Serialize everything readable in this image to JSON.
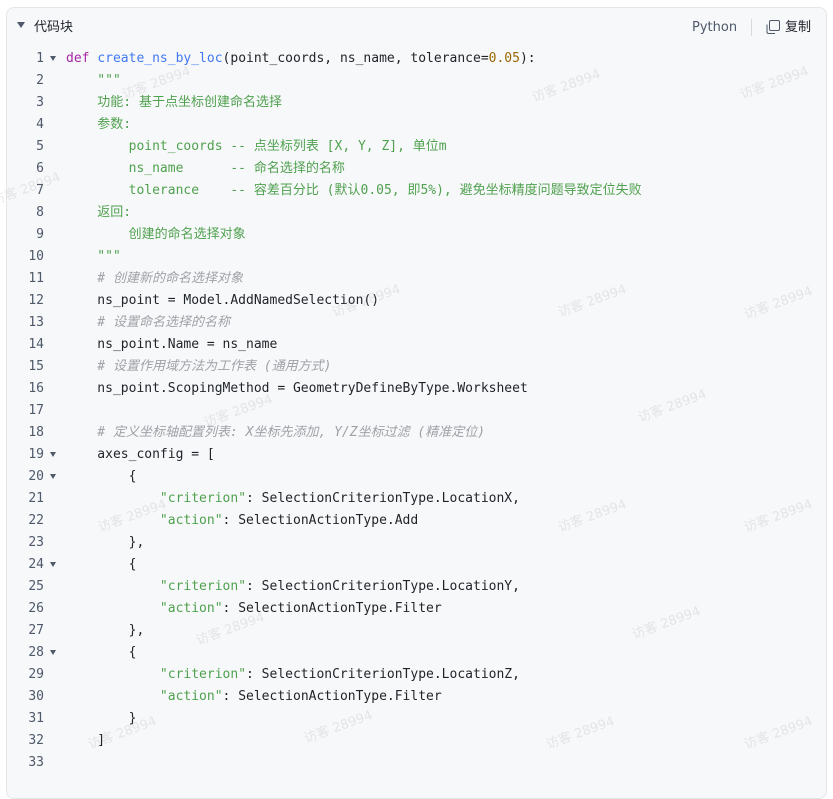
{
  "header": {
    "title": "代码块",
    "language": "Python",
    "copy_label": "复制"
  },
  "icons": {
    "collapse": "caret-down-icon",
    "copy": "copy-icon",
    "fold": "fold-caret-icon"
  },
  "colors": {
    "keyword": "#a626a4",
    "function": "#4078f2",
    "number": "#986801",
    "string": "#50a14f",
    "comment": "#a0a1a7",
    "text": "#1f2328",
    "background": "#f7f8fa",
    "border": "#e4e6ea"
  },
  "watermark_text": "访客 28994",
  "code_lines": [
    {
      "n": "1",
      "fold": true,
      "tokens": [
        [
          "kw",
          "def"
        ],
        [
          "p",
          " "
        ],
        [
          "fn",
          "create_ns_by_loc"
        ],
        [
          "p",
          "(point_coords, ns_name, tolerance="
        ],
        [
          "num",
          "0.05"
        ],
        [
          "p",
          "):"
        ]
      ]
    },
    {
      "n": "2",
      "fold": false,
      "tokens": [
        [
          "str",
          "    \"\"\""
        ]
      ]
    },
    {
      "n": "3",
      "fold": false,
      "tokens": [
        [
          "str",
          "    功能: 基于点坐标创建命名选择"
        ]
      ]
    },
    {
      "n": "4",
      "fold": false,
      "tokens": [
        [
          "str",
          "    参数:"
        ]
      ]
    },
    {
      "n": "5",
      "fold": false,
      "tokens": [
        [
          "str",
          "        point_coords -- 点坐标列表 [X, Y, Z], 单位m"
        ]
      ]
    },
    {
      "n": "6",
      "fold": false,
      "tokens": [
        [
          "str",
          "        ns_name      -- 命名选择的名称"
        ]
      ]
    },
    {
      "n": "7",
      "fold": false,
      "tokens": [
        [
          "str",
          "        tolerance    -- 容差百分比 (默认0.05, 即5%), 避免坐标精度问题导致定位失败"
        ]
      ]
    },
    {
      "n": "8",
      "fold": false,
      "tokens": [
        [
          "str",
          "    返回:"
        ]
      ]
    },
    {
      "n": "9",
      "fold": false,
      "tokens": [
        [
          "str",
          "        创建的命名选择对象"
        ]
      ]
    },
    {
      "n": "10",
      "fold": false,
      "tokens": [
        [
          "str",
          "    \"\"\""
        ]
      ]
    },
    {
      "n": "11",
      "fold": false,
      "tokens": [
        [
          "com",
          "    # 创建新的命名选择对象"
        ]
      ]
    },
    {
      "n": "12",
      "fold": false,
      "tokens": [
        [
          "p",
          "    ns_point = Model.AddNamedSelection()"
        ]
      ]
    },
    {
      "n": "13",
      "fold": false,
      "tokens": [
        [
          "com",
          "    # 设置命名选择的名称"
        ]
      ]
    },
    {
      "n": "14",
      "fold": false,
      "tokens": [
        [
          "p",
          "    ns_point.Name = ns_name"
        ]
      ]
    },
    {
      "n": "15",
      "fold": false,
      "tokens": [
        [
          "com",
          "    # 设置作用域方法为工作表 (通用方式)"
        ]
      ]
    },
    {
      "n": "16",
      "fold": false,
      "tokens": [
        [
          "p",
          "    ns_point.ScopingMethod = GeometryDefineByType.Worksheet"
        ]
      ]
    },
    {
      "n": "17",
      "fold": false,
      "tokens": [
        [
          "p",
          ""
        ]
      ]
    },
    {
      "n": "18",
      "fold": false,
      "tokens": [
        [
          "com",
          "    # 定义坐标轴配置列表: X坐标先添加, Y/Z坐标过滤 (精准定位)"
        ]
      ]
    },
    {
      "n": "19",
      "fold": true,
      "tokens": [
        [
          "p",
          "    axes_config = ["
        ]
      ]
    },
    {
      "n": "20",
      "fold": true,
      "tokens": [
        [
          "p",
          "        {"
        ]
      ]
    },
    {
      "n": "21",
      "fold": false,
      "tokens": [
        [
          "p",
          "            "
        ],
        [
          "str",
          "\"criterion\""
        ],
        [
          "p",
          ": SelectionCriterionType.LocationX,"
        ]
      ]
    },
    {
      "n": "22",
      "fold": false,
      "tokens": [
        [
          "p",
          "            "
        ],
        [
          "str",
          "\"action\""
        ],
        [
          "p",
          ": SelectionActionType.Add"
        ]
      ]
    },
    {
      "n": "23",
      "fold": false,
      "tokens": [
        [
          "p",
          "        },"
        ]
      ]
    },
    {
      "n": "24",
      "fold": true,
      "tokens": [
        [
          "p",
          "        {"
        ]
      ]
    },
    {
      "n": "25",
      "fold": false,
      "tokens": [
        [
          "p",
          "            "
        ],
        [
          "str",
          "\"criterion\""
        ],
        [
          "p",
          ": SelectionCriterionType.LocationY,"
        ]
      ]
    },
    {
      "n": "26",
      "fold": false,
      "tokens": [
        [
          "p",
          "            "
        ],
        [
          "str",
          "\"action\""
        ],
        [
          "p",
          ": SelectionActionType.Filter"
        ]
      ]
    },
    {
      "n": "27",
      "fold": false,
      "tokens": [
        [
          "p",
          "        },"
        ]
      ]
    },
    {
      "n": "28",
      "fold": true,
      "tokens": [
        [
          "p",
          "        {"
        ]
      ]
    },
    {
      "n": "29",
      "fold": false,
      "tokens": [
        [
          "p",
          "            "
        ],
        [
          "str",
          "\"criterion\""
        ],
        [
          "p",
          ": SelectionCriterionType.LocationZ,"
        ]
      ]
    },
    {
      "n": "30",
      "fold": false,
      "tokens": [
        [
          "p",
          "            "
        ],
        [
          "str",
          "\"action\""
        ],
        [
          "p",
          ": SelectionActionType.Filter"
        ]
      ]
    },
    {
      "n": "31",
      "fold": false,
      "tokens": [
        [
          "p",
          "        }"
        ]
      ]
    },
    {
      "n": "32",
      "fold": false,
      "tokens": [
        [
          "p",
          "    ]"
        ]
      ]
    },
    {
      "n": "33",
      "fold": false,
      "tokens": [
        [
          "p",
          ""
        ]
      ]
    }
  ]
}
